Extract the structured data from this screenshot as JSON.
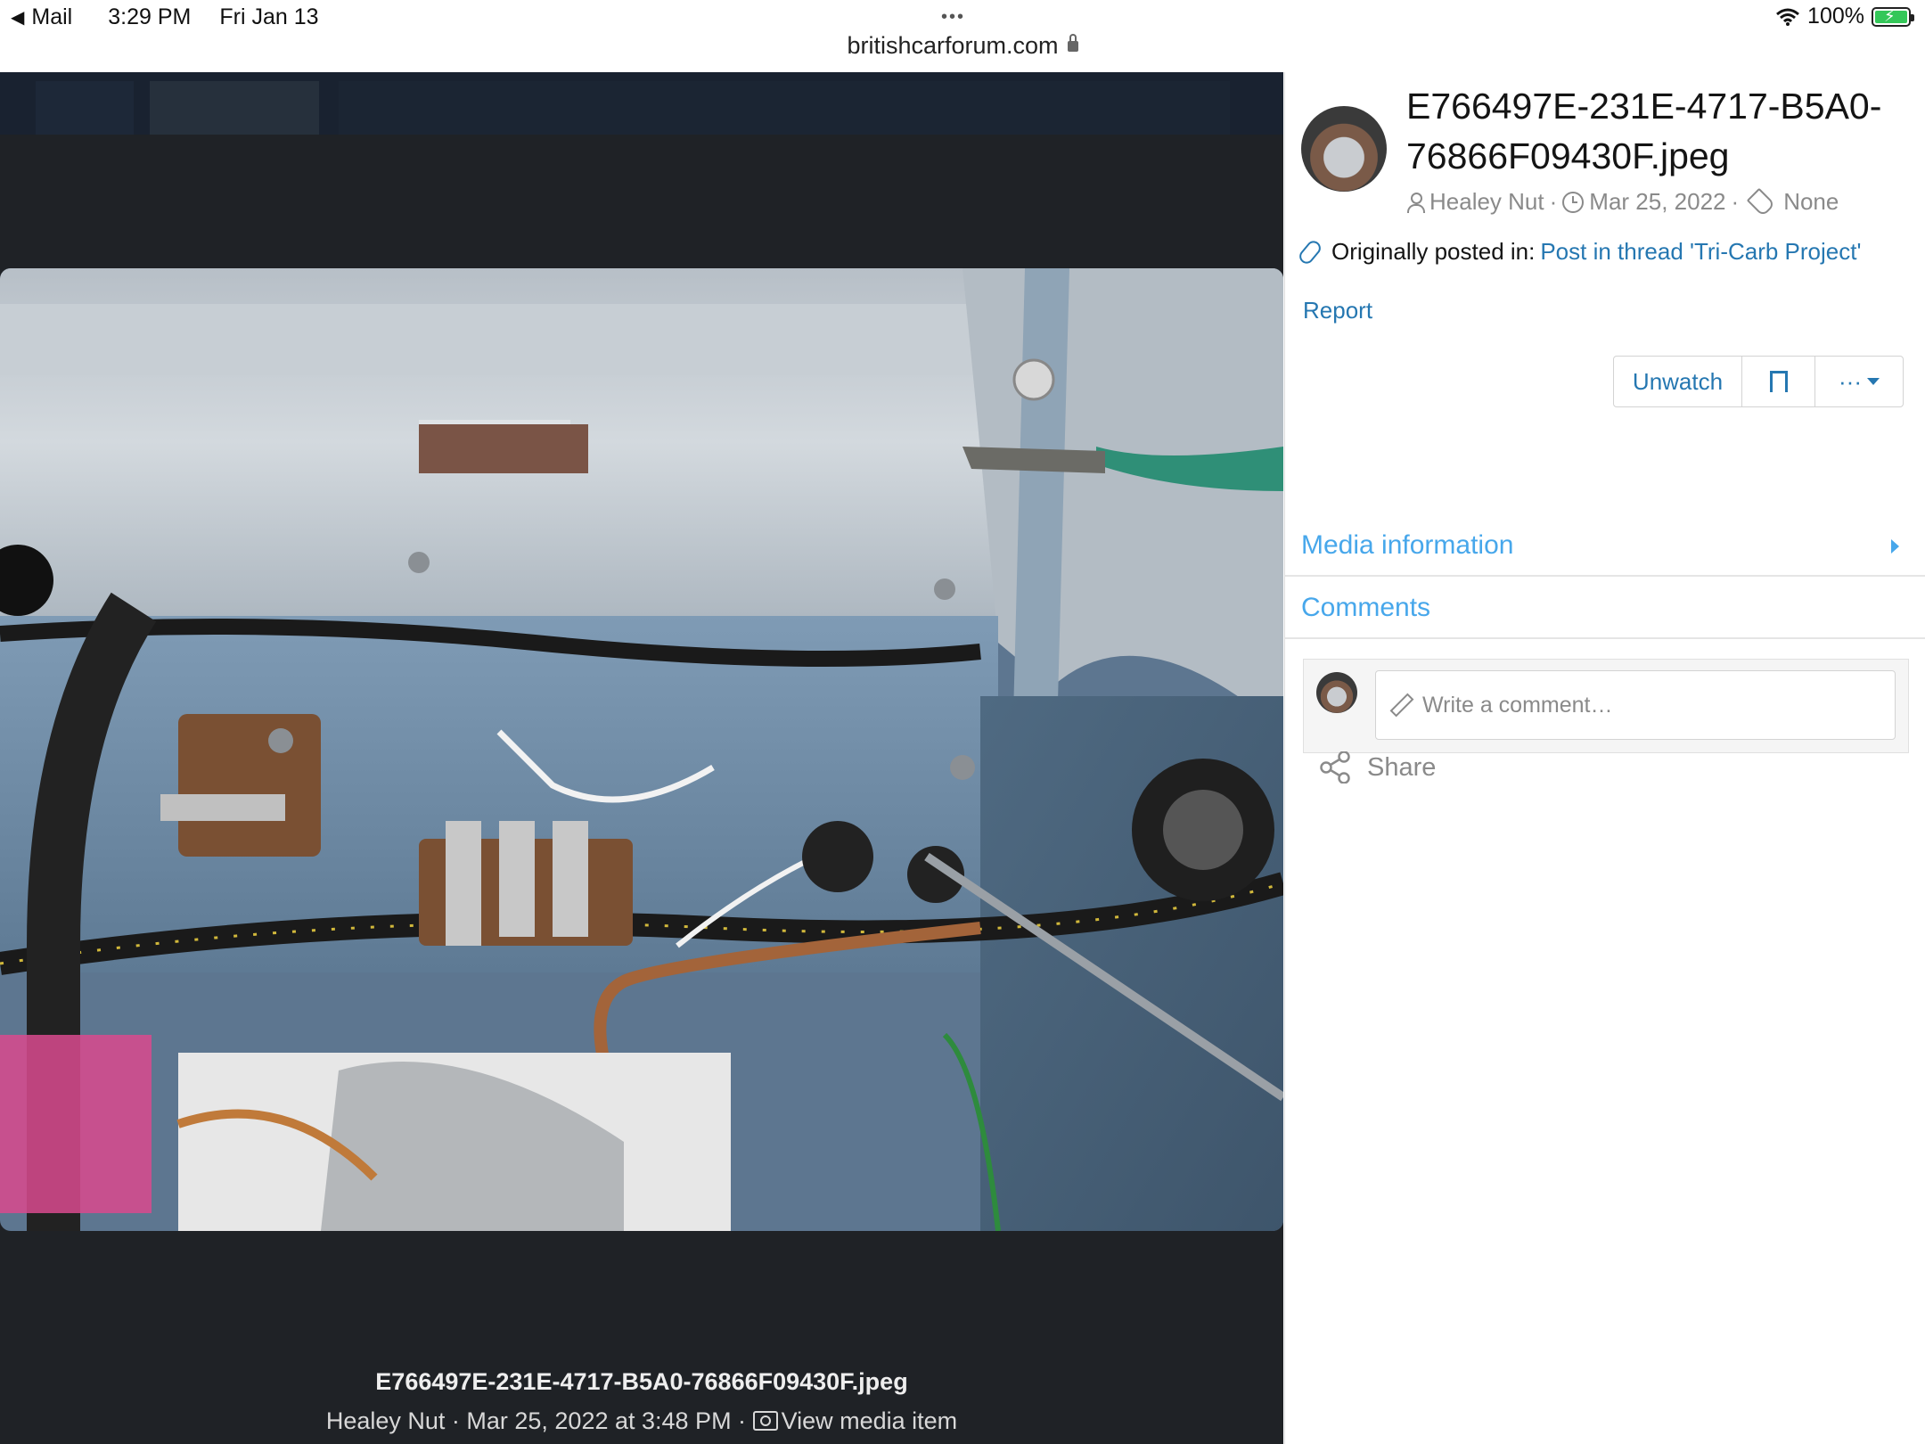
{
  "status_bar": {
    "back_label": "Mail",
    "time": "3:29 PM",
    "date": "Fri Jan 13",
    "battery": "100%"
  },
  "browser": {
    "url": "britishcarforum.com"
  },
  "viewer": {
    "caption_title": "E766497E-231E-4717-B5A0-76866F09430F.jpeg",
    "caption_meta": "Healey Nut · Mar 25, 2022 at 3:48 PM ·",
    "view_media_label": "View media item"
  },
  "sidebar": {
    "title": "E766497E-231E-4717-B5A0-76866F09430F.jpeg",
    "author": "Healey Nut",
    "date": "Mar 25, 2022",
    "tags": "None",
    "originally_posted_label": "Originally posted in:",
    "thread_link": "Post in thread 'Tri-Carb Project'",
    "report_label": "Report",
    "unwatch_label": "Unwatch",
    "more_label": "···",
    "media_info_label": "Media information",
    "comments_label": "Comments",
    "comment_placeholder": "Write a comment…",
    "share_label": "Share"
  },
  "colors": {
    "link": "#2577b1",
    "section_head": "#47a7eb",
    "viewer_bg": "#1f2226"
  }
}
